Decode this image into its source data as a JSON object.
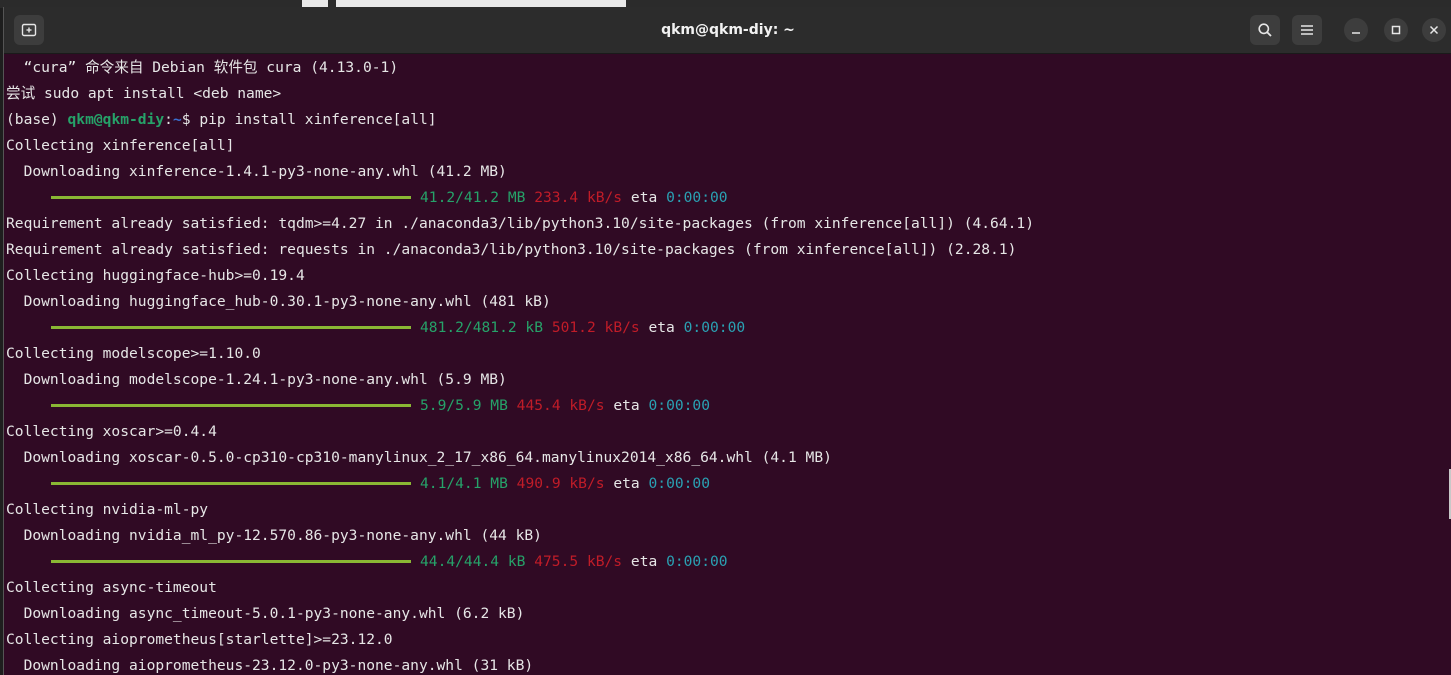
{
  "window": {
    "title": "qkm@qkm-diy: ~"
  },
  "colors": {
    "terminal_bg": "#300a24",
    "user_host": "#26a269",
    "path": "#3a6fd0",
    "progress": "#8ab834",
    "size": "#26a269",
    "speed": "#c01c28",
    "eta_time": "#2aa1b3"
  },
  "icons": {
    "new_tab": "new-tab-icon",
    "search": "search-icon",
    "menu": "hamburger-menu-icon",
    "minimize": "minimize-icon",
    "maximize": "maximize-icon",
    "close": "close-icon"
  },
  "terminal": {
    "line1": "  “cura” 命令来自 Debian 软件包 cura (4.13.0-1)",
    "line2": "尝试 sudo apt install <deb name>",
    "prompt": {
      "env": "(base) ",
      "user_host": "qkm@qkm-diy",
      "sep": ":",
      "path": "~",
      "symbol": "$ ",
      "command": "pip install xinference[all]"
    },
    "l4": "Collecting xinference[all]",
    "l5": "  Downloading xinference-1.4.1-py3-none-any.whl (41.2 MB)",
    "p1": {
      "progress": 1.0,
      "size": "41.2/41.2 MB",
      "speed": "233.4 kB/s",
      "eta": "eta",
      "time": "0:00:00"
    },
    "l7": "Requirement already satisfied: tqdm>=4.27 in ./anaconda3/lib/python3.10/site-packages (from xinference[all]) (4.64.1)",
    "l8": "Requirement already satisfied: requests in ./anaconda3/lib/python3.10/site-packages (from xinference[all]) (2.28.1)",
    "l9": "Collecting huggingface-hub>=0.19.4",
    "l10": "  Downloading huggingface_hub-0.30.1-py3-none-any.whl (481 kB)",
    "p2": {
      "progress": 1.0,
      "size": "481.2/481.2 kB",
      "speed": "501.2 kB/s",
      "eta": "eta",
      "time": "0:00:00"
    },
    "l12": "Collecting modelscope>=1.10.0",
    "l13": "  Downloading modelscope-1.24.1-py3-none-any.whl (5.9 MB)",
    "p3": {
      "progress": 1.0,
      "size": "5.9/5.9 MB",
      "speed": "445.4 kB/s",
      "eta": "eta",
      "time": "0:00:00"
    },
    "l15": "Collecting xoscar>=0.4.4",
    "l16": "  Downloading xoscar-0.5.0-cp310-cp310-manylinux_2_17_x86_64.manylinux2014_x86_64.whl (4.1 MB)",
    "p4": {
      "progress": 1.0,
      "size": "4.1/4.1 MB",
      "speed": "490.9 kB/s",
      "eta": "eta",
      "time": "0:00:00"
    },
    "l18": "Collecting nvidia-ml-py",
    "l19": "  Downloading nvidia_ml_py-12.570.86-py3-none-any.whl (44 kB)",
    "p5": {
      "progress": 1.0,
      "size": "44.4/44.4 kB",
      "speed": "475.5 kB/s",
      "eta": "eta",
      "time": "0:00:00"
    },
    "l21": "Collecting async-timeout",
    "l22": "  Downloading async_timeout-5.0.1-py3-none-any.whl (6.2 kB)",
    "l23": "Collecting aioprometheus[starlette]>=23.12.0",
    "l24": "  Downloading aioprometheus-23.12.0-py3-none-any.whl (31 kB)"
  }
}
